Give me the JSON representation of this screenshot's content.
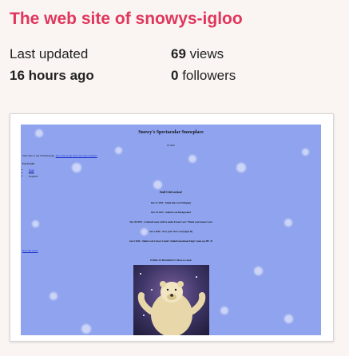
{
  "header": {
    "title": "The web site of snowys-igloo"
  },
  "stats": {
    "last_updated_label": "Last updated",
    "last_updated_value": "16 hours ago",
    "views_count": "69",
    "views_label": "views",
    "followers_count": "0",
    "followers_label": "followers"
  },
  "screenshot": {
    "page_title": "Snowy's Spectacular Snowplace",
    "subtitle": "Or hello",
    "welcome_text": "Welcome to my Webbertpage.",
    "welcome_link": "Now this is my brew favorite website!",
    "foods_heading": "Fav Foods",
    "foods": [
      "Steak",
      "Pizza",
      "Spaghetti"
    ],
    "stuff_heading": "Stuff I did section!",
    "log": [
      "Dec 27 2025 - Made this Cool Webpage",
      "Dec 29 2025 - Added Cool Background",
      "Dec 30 2025 - Centered some stuff to make it look Cool + Made your mouse Cool",
      "Jan 1 2026 - New year! New Cool page! B)",
      "Jan 3 2026 - Made Cool Cursor Cooler! Added Guestbook Page! Come say Hi! :D"
    ],
    "does_this_work_link": "Does this work?",
    "wip_text": "WORK IN PROGRESS!! More to come!",
    "image_alt": "polar bear"
  },
  "colors": {
    "title": "#e0365c",
    "page_bg": "#faf5f3",
    "screenshot_bg": "#8fa3ee"
  }
}
